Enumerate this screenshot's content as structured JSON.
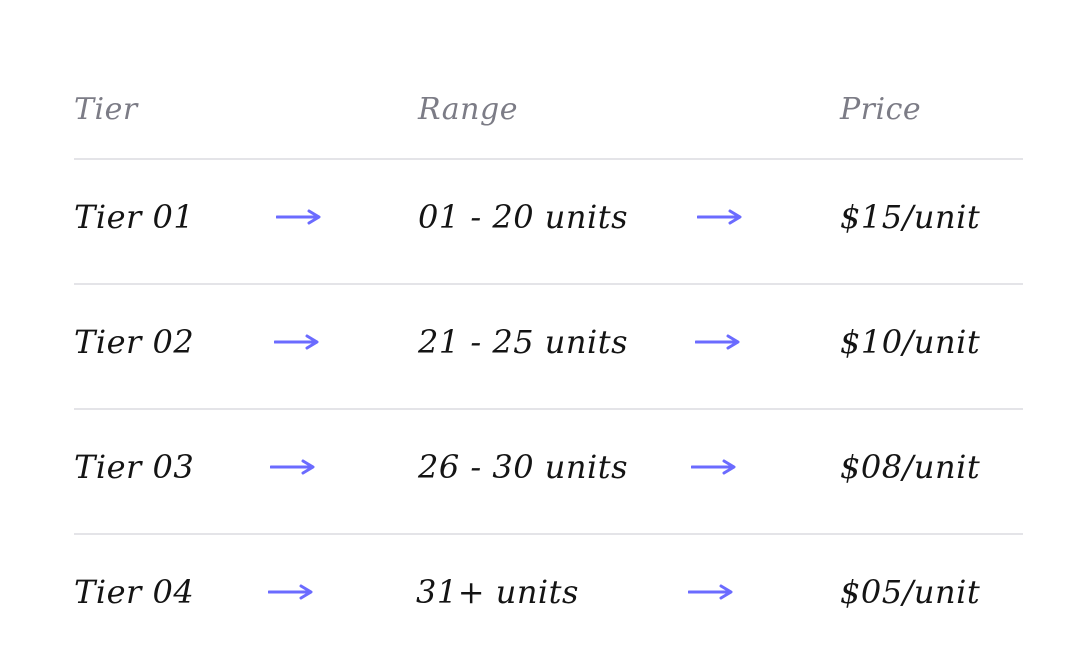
{
  "header": {
    "tier": "Tier",
    "range": "Range",
    "price": "Price"
  },
  "rows": [
    {
      "tier": "Tier 01",
      "range": "01 - 20 units",
      "price": "$15/unit"
    },
    {
      "tier": "Tier 02",
      "range": "21 - 25 units",
      "price": "$10/unit"
    },
    {
      "tier": "Tier 03",
      "range": "26 - 30 units",
      "price": "$08/unit"
    },
    {
      "tier": "Tier 04",
      "range": "31+ units",
      "price": "$05/unit"
    }
  ],
  "colors": {
    "accent": "#6b6bff",
    "text": "#141414",
    "header_text": "#7c7c86",
    "divider": "#e4e4e8"
  },
  "icons": {
    "arrow": "arrow-right-icon"
  }
}
